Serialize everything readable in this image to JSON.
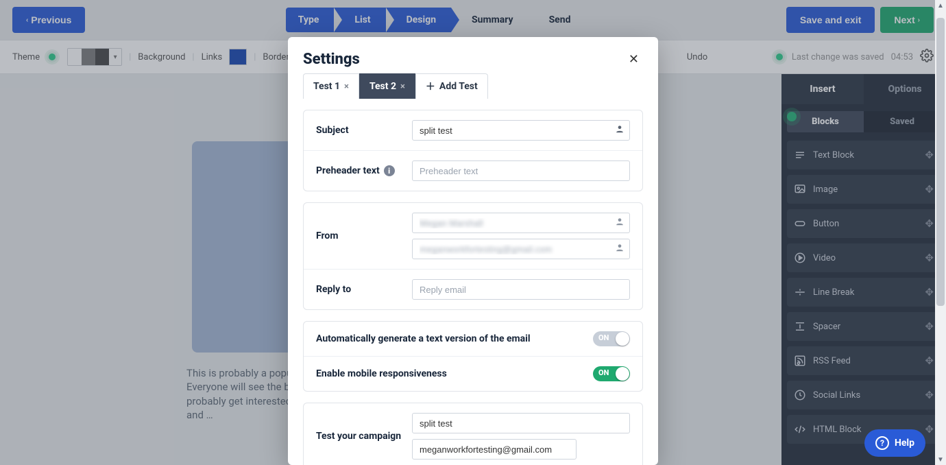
{
  "topbar": {
    "prev": "Previous",
    "save_exit": "Save and exit",
    "next": "Next"
  },
  "steps": [
    "Type",
    "List",
    "Design",
    "Summary",
    "Send"
  ],
  "toolbar": {
    "theme": "Theme",
    "background": "Background",
    "links": "Links",
    "border": "Border",
    "undo": "Undo",
    "status_text": "Last change was saved",
    "status_time": "04:53"
  },
  "canvas": {
    "caption": "This is probably a popular product or a deal you're proud of. Everyone will see the big photo of it, maybe click on it and probably get interested enough to scroll down to visit the shop and …"
  },
  "sidebar": {
    "tabs": [
      "Insert",
      "Options"
    ],
    "subtabs": [
      "Blocks",
      "Saved"
    ],
    "blocks": [
      "Text Block",
      "Image",
      "Button",
      "Video",
      "Line Break",
      "Spacer",
      "RSS Feed",
      "Social Links",
      "HTML Block"
    ]
  },
  "modal": {
    "title": "Settings",
    "tabs": {
      "t1": "Test 1",
      "t2": "Test 2",
      "add": "Add Test"
    },
    "rows": {
      "subject_label": "Subject",
      "subject_value": "split test",
      "preheader_label": "Preheader text",
      "preheader_placeholder": "Preheader text",
      "from_label": "From",
      "from_name": "Megan Marshall",
      "from_email": "meganworkfortesting@gmail.com",
      "replyto_label": "Reply to",
      "replyto_placeholder": "Reply email",
      "auto_text": "Automatically generate a text version of the email",
      "mobile": "Enable mobile responsiveness",
      "on": "ON",
      "test_label": "Test your campaign",
      "test_subject": "split test",
      "test_email": "meganworkfortesting@gmail.com"
    }
  },
  "help": "Help"
}
